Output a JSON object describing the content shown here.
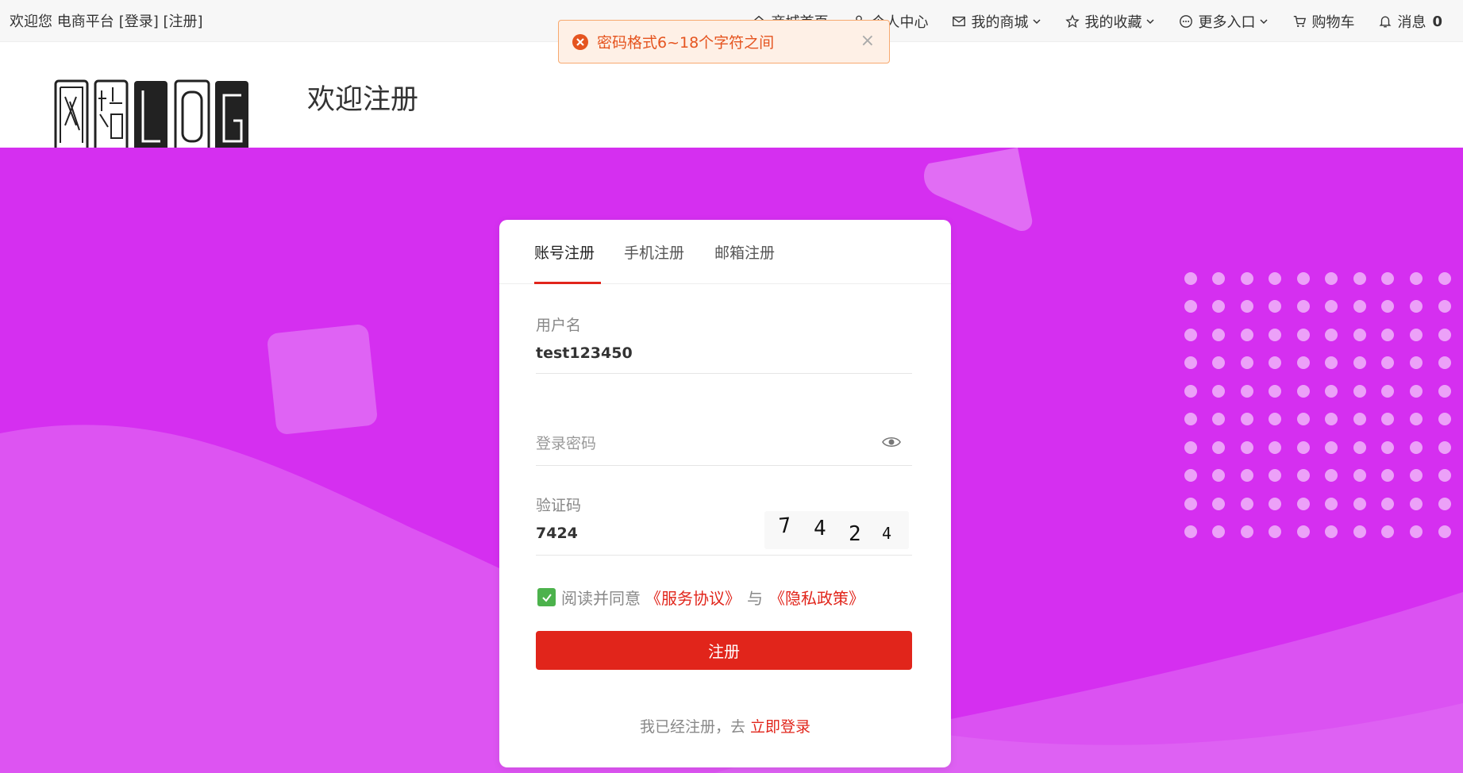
{
  "topbar": {
    "welcome": "欢迎您 电商平台",
    "login": "[登录]",
    "register": "[注册]",
    "nav": [
      {
        "label": "商城首页",
        "icon": "home-icon"
      },
      {
        "label": "个人中心",
        "icon": "user-icon"
      },
      {
        "label": "我的商城",
        "icon": "mail-icon",
        "dropdown": true
      },
      {
        "label": "我的收藏",
        "icon": "star-icon",
        "dropdown": true
      },
      {
        "label": "更多入口",
        "icon": "more-icon",
        "dropdown": true
      },
      {
        "label": "购物车",
        "icon": "cart-icon"
      },
      {
        "label": "消息",
        "icon": "bell-icon",
        "count": "0"
      }
    ]
  },
  "toast": {
    "message": "密码格式6~18个字符之间",
    "type": "error",
    "close": "×"
  },
  "header": {
    "title": "欢迎注册"
  },
  "tabs": [
    {
      "label": "账号注册",
      "active": true
    },
    {
      "label": "手机注册",
      "active": false
    },
    {
      "label": "邮箱注册",
      "active": false
    }
  ],
  "form": {
    "username_label": "用户名",
    "username_value": "test123450",
    "password_placeholder": "登录密码",
    "captcha_label": "验证码",
    "captcha_value": "7424",
    "captcha_chars": [
      "7",
      "4",
      "2",
      "4"
    ],
    "agree_text": "阅读并同意",
    "service_link": "《服务协议》",
    "and_text": "与",
    "privacy_link": "《隐私政策》",
    "agree_checked": true,
    "submit_label": "注册",
    "already_text": "我已经注册，去",
    "login_link": "立即登录"
  },
  "colors": {
    "accent": "#e1251b",
    "banner": "#d52ff0",
    "checkbox": "#4cb24c",
    "toast_text": "#e5541f"
  }
}
